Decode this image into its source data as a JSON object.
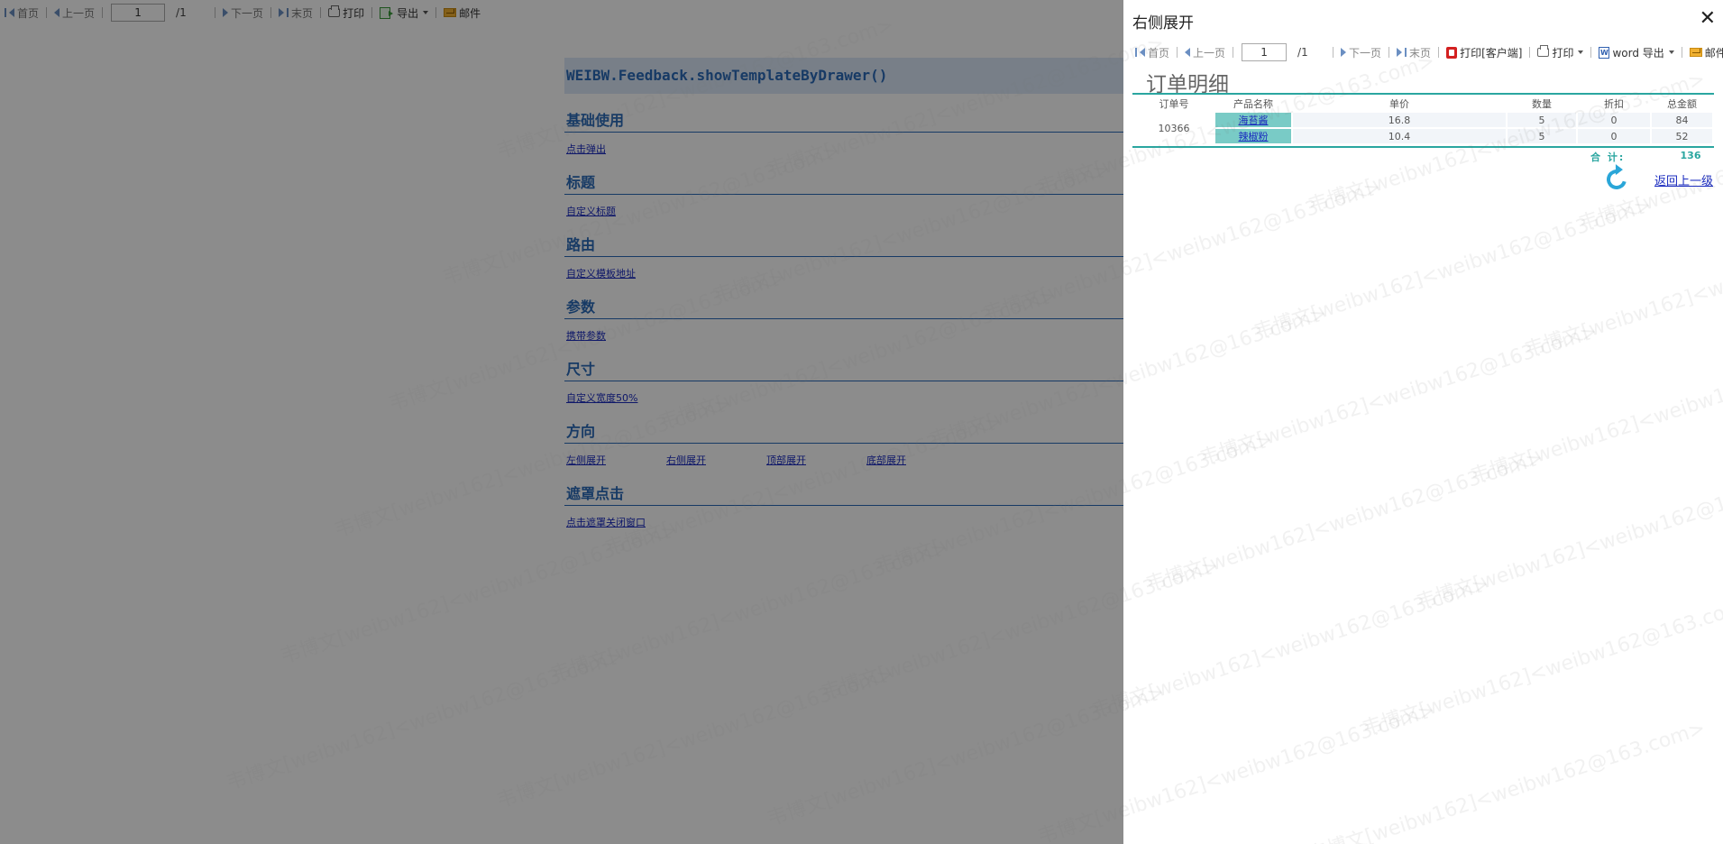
{
  "toolbar": {
    "first": "首页",
    "prev": "上一页",
    "page_value": "1",
    "page_total": "/1",
    "next": "下一页",
    "last": "末页",
    "print": "打印",
    "export": "导出",
    "mail": "邮件"
  },
  "doc": {
    "title": "WEIBW.Feedback.showTemplateByDrawer()",
    "sections": [
      {
        "heading": "基础使用",
        "links": [
          "点击弹出"
        ]
      },
      {
        "heading": "标题",
        "links": [
          "自定义标题"
        ]
      },
      {
        "heading": "路由",
        "links": [
          "自定义模板地址"
        ]
      },
      {
        "heading": "参数",
        "links": [
          "携带参数"
        ]
      },
      {
        "heading": "尺寸",
        "links": [
          "自定义宽度50%"
        ]
      },
      {
        "heading": "方向",
        "links": [
          "左侧展开",
          "右侧展开",
          "顶部展开",
          "底部展开"
        ]
      },
      {
        "heading": "遮罩点击",
        "links": [
          "点击遮罩关闭窗口"
        ]
      }
    ]
  },
  "drawer": {
    "title": "右侧展开",
    "close_glyph": "✕",
    "toolbar": {
      "first": "首页",
      "prev": "上一页",
      "page_value": "1",
      "page_total": "/1",
      "next": "下一页",
      "last": "末页",
      "print_client": "打印[客户端]",
      "print": "打印",
      "word_export": "word 导出",
      "mail": "邮件"
    },
    "report_title": "订单明细",
    "table": {
      "headers": [
        "订单号",
        "产品名称",
        "单价",
        "数量",
        "折扣",
        "总金额"
      ],
      "order_no": "10366",
      "rows": [
        {
          "product": "海苔酱",
          "price": "16.8",
          "qty": "5",
          "discount": "0",
          "amount": "84"
        },
        {
          "product": "辣椒粉",
          "price": "10.4",
          "qty": "5",
          "discount": "0",
          "amount": "52"
        }
      ]
    },
    "total_label": "合 计:",
    "total_value": "136",
    "back_link": "返回上一级"
  },
  "watermark_text": "韦博文[weibw162]<weibw162@163.com>",
  "colors": {
    "accent": "#2aa6a0",
    "link": "#1a2bbf",
    "heading": "#2a6ab8",
    "mask": "rgba(0,0,0,0.45)"
  }
}
